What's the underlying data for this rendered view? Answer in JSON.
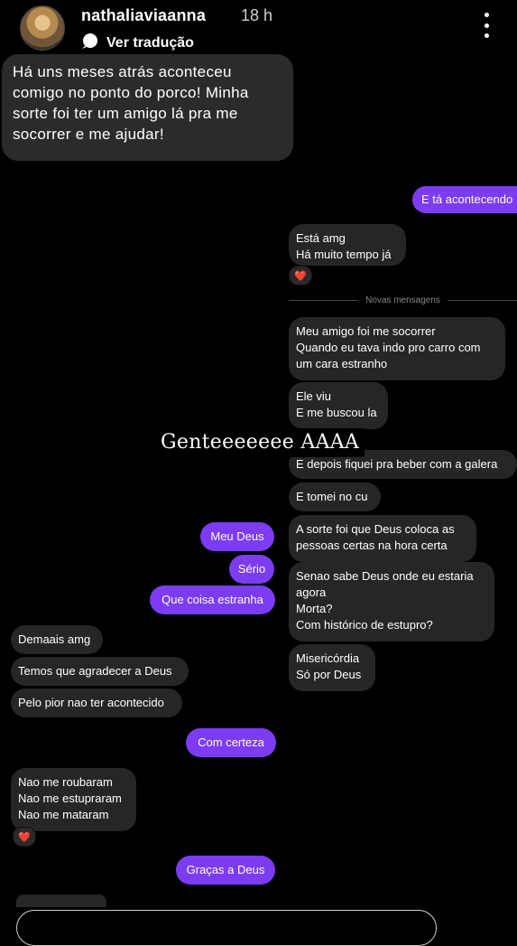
{
  "header": {
    "username": "nathaliaviaanna",
    "time": "18 h",
    "translate_label": "Ver tradução"
  },
  "caption": "Há uns meses atrás aconteceu comigo no ponto do porco! Minha sorte foi ter um amigo lá pra me socorrer e me ajudar!",
  "overlay_text": "Genteeeeeee AAAA",
  "divider_label": "Novas mensagens",
  "messages": [
    {
      "side": "out",
      "text": "E tá acontecendo"
    },
    {
      "side": "in",
      "text": "Está amg\nHá muito tempo já"
    },
    {
      "side": "in",
      "text": "Meu amigo foi me socorrer\nQuando eu tava indo pro carro com\num cara estranho"
    },
    {
      "side": "in",
      "text": "Ele viu\nE me buscou la"
    },
    {
      "side": "in",
      "text": "E depois fiquei pra beber com a galera"
    },
    {
      "side": "in",
      "text": "E tomei no cu"
    },
    {
      "side": "in",
      "text": "A sorte foi que Deus coloca as\npessoas certas na hora certa"
    },
    {
      "side": "in",
      "text": "Senao sabe Deus onde eu estaria\nagora\nMorta?\nCom histórico de estupro?"
    },
    {
      "side": "in",
      "text": "Misericórdia\nSó por Deus"
    },
    {
      "side": "out",
      "text": "Meu Deus"
    },
    {
      "side": "out",
      "text": "Sério"
    },
    {
      "side": "out",
      "text": "Que coisa estranha"
    },
    {
      "side": "in",
      "text": "Demaais amg"
    },
    {
      "side": "in",
      "text": "Temos que agradecer a Deus"
    },
    {
      "side": "in",
      "text": "Pelo pior nao ter acontecido"
    },
    {
      "side": "out",
      "text": "Com certeza"
    },
    {
      "side": "in",
      "text": "Nao me roubaram\nNao me estupraram\nNao me mataram"
    },
    {
      "side": "out",
      "text": "Graças a Deus"
    }
  ],
  "reaction": "❤️",
  "colors": {
    "outgoing": "#7b3cf2",
    "incoming": "#262626",
    "background": "#000000"
  },
  "icons": [
    "more-vertical-icon",
    "translate-icon",
    "heart-reaction-icon"
  ]
}
